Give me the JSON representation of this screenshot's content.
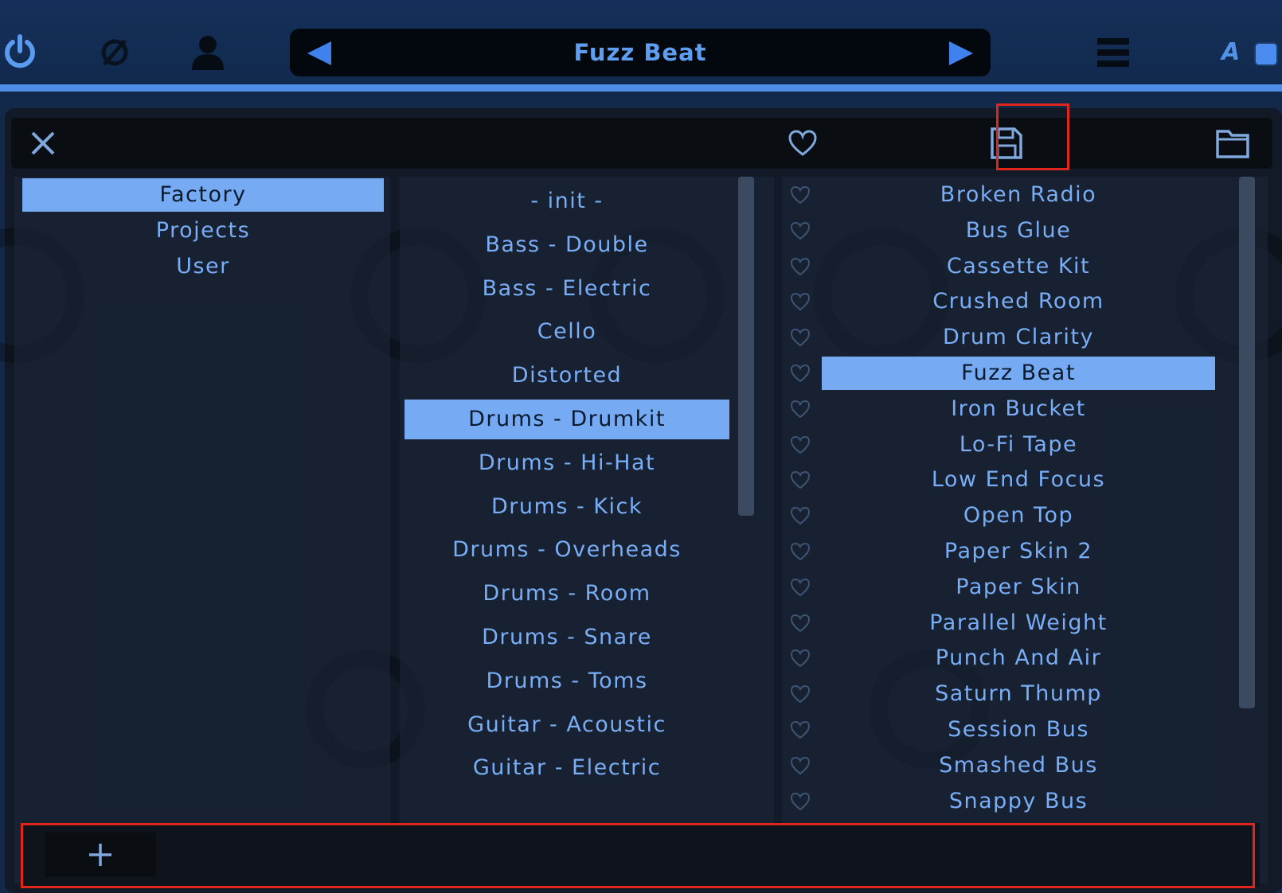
{
  "header": {
    "preset_name": "Fuzz Beat",
    "a_label": "A"
  },
  "columns": {
    "banks": {
      "items": [
        "Factory",
        "Projects",
        "User"
      ],
      "selected_index": 0
    },
    "categories": {
      "items": [
        "- init -",
        "Bass - Double",
        "Bass - Electric",
        "Cello",
        "Distorted",
        "Drums - Drumkit",
        "Drums - Hi-Hat",
        "Drums - Kick",
        "Drums - Overheads",
        "Drums - Room",
        "Drums - Snare",
        "Drums - Toms",
        "Guitar - Acoustic",
        "Guitar - Electric"
      ],
      "selected_index": 5
    },
    "presets": {
      "items": [
        "Broken Radio",
        "Bus Glue",
        "Cassette Kit",
        "Crushed Room",
        "Drum Clarity",
        "Fuzz Beat",
        "Iron Bucket",
        "Lo-Fi Tape",
        "Low End Focus",
        "Open Top",
        "Paper Skin 2",
        "Paper Skin",
        "Parallel Weight",
        "Punch And Air",
        "Saturn Thump",
        "Session Bus",
        "Smashed Bus",
        "Snappy Bus"
      ],
      "selected_index": 5
    }
  },
  "icons": {
    "power": "power-icon",
    "phase": "phase-invert-icon",
    "user": "user-icon",
    "menu": "hamburger-menu-icon",
    "close": "close-icon",
    "favorite": "heart-icon",
    "save": "save-icon",
    "folder": "folder-icon",
    "add": "plus-icon"
  },
  "colors": {
    "accent": "#76aaf3",
    "highlight_box": "#e0251b",
    "text": "#79aef7"
  }
}
